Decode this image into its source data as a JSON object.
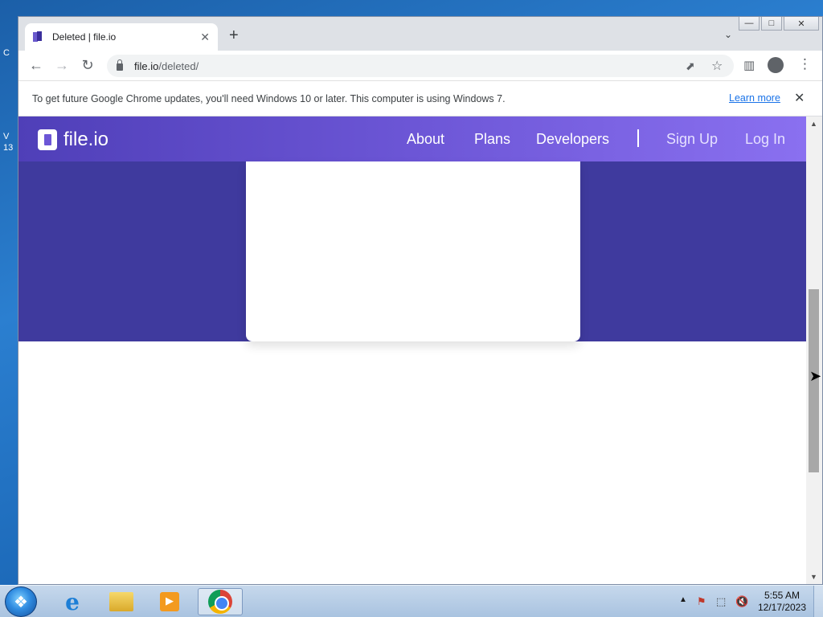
{
  "desktop": {
    "labels": [
      "C",
      "V",
      "13"
    ]
  },
  "window": {
    "controls": {
      "minimize": "—",
      "restore": "□",
      "close": "✕"
    }
  },
  "tab": {
    "title": "Deleted | file.io",
    "close": "✕",
    "new_tab": "+",
    "dropdown": "⌄"
  },
  "toolbar": {
    "back": "←",
    "forward": "→",
    "reload": "↻",
    "url_host": "file.io",
    "url_path": "/deleted/",
    "share": "⬈",
    "bookmark": "☆",
    "side_panel": "▥",
    "menu": "⋮"
  },
  "infobar": {
    "message": "To get future Google Chrome updates, you'll need Windows 10 or later. This computer is using Windows 7.",
    "learn_more": "Learn more",
    "close": "✕"
  },
  "site": {
    "logo_text": "file.io",
    "nav": {
      "about": "About",
      "plans": "Plans",
      "developers": "Developers",
      "sign_up": "Sign Up",
      "log_in": "Log In"
    },
    "colors": {
      "nav_start": "#4f3fb8",
      "nav_end": "#8a70f0",
      "hero": "#3f3a9e"
    }
  },
  "scrollbar": {
    "up": "▲",
    "down": "▼"
  },
  "taskbar": {
    "tray_arrow": "▲",
    "tray_icons": [
      "⚑",
      "⬚",
      "🔇"
    ],
    "time": "5:55 AM",
    "date": "12/17/2023"
  },
  "icons": [
    "start-orb-icon",
    "internet-explorer-icon",
    "file-explorer-icon",
    "media-player-icon",
    "chrome-icon",
    "lock-icon",
    "file-io-logo-icon"
  ]
}
